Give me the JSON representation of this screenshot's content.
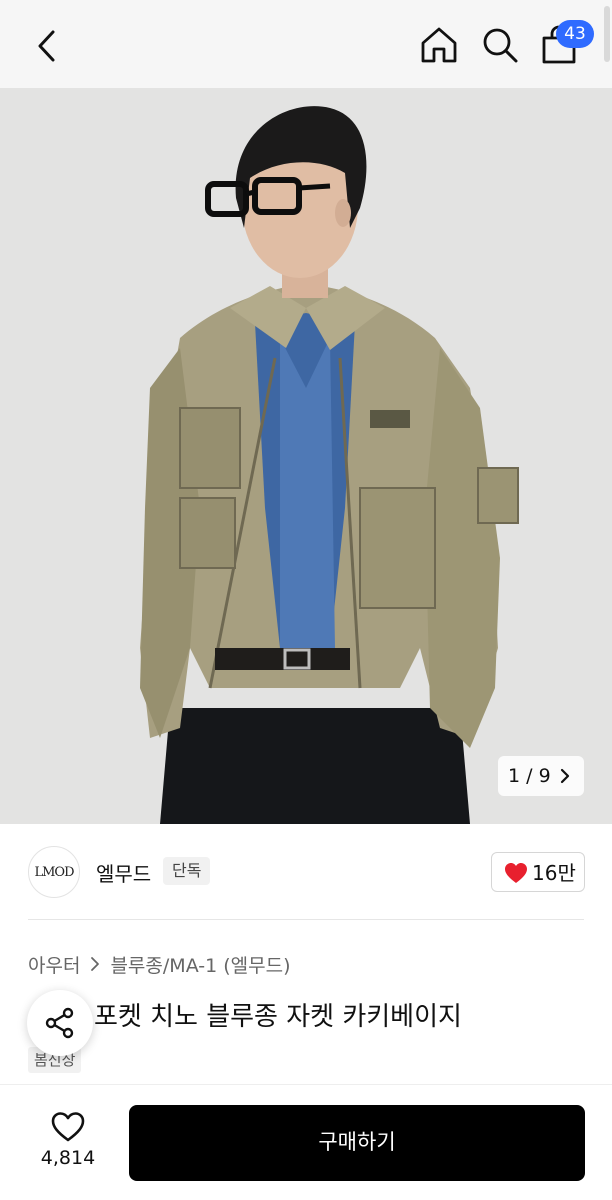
{
  "topbar": {
    "back_icon": "chevron-left-icon",
    "home_icon": "home-icon",
    "search_icon": "search-icon",
    "cart_icon": "shopping-bag-icon",
    "cart_count": "43",
    "badge_color": "#2f6bff"
  },
  "gallery": {
    "pager": "1 / 9",
    "pager_icon": "chevron-right-icon"
  },
  "brand": {
    "logo_text": "LMOD",
    "name": "엘무드",
    "tag": "단독",
    "like_count": "16만",
    "like_icon": "heart-filled-icon",
    "like_color": "#e8202e"
  },
  "product": {
    "breadcrumb": [
      "아우터",
      "블루종/MA-1 (엘무드)"
    ],
    "title": "포켓 치노 블루종 자켓 카키베이지",
    "season_badge": "봄신상",
    "share_icon": "share-icon"
  },
  "bottom": {
    "wish_icon": "heart-outline-icon",
    "wish_count": "4,814",
    "buy_label": "구매하기",
    "buy_color": "#000000"
  }
}
